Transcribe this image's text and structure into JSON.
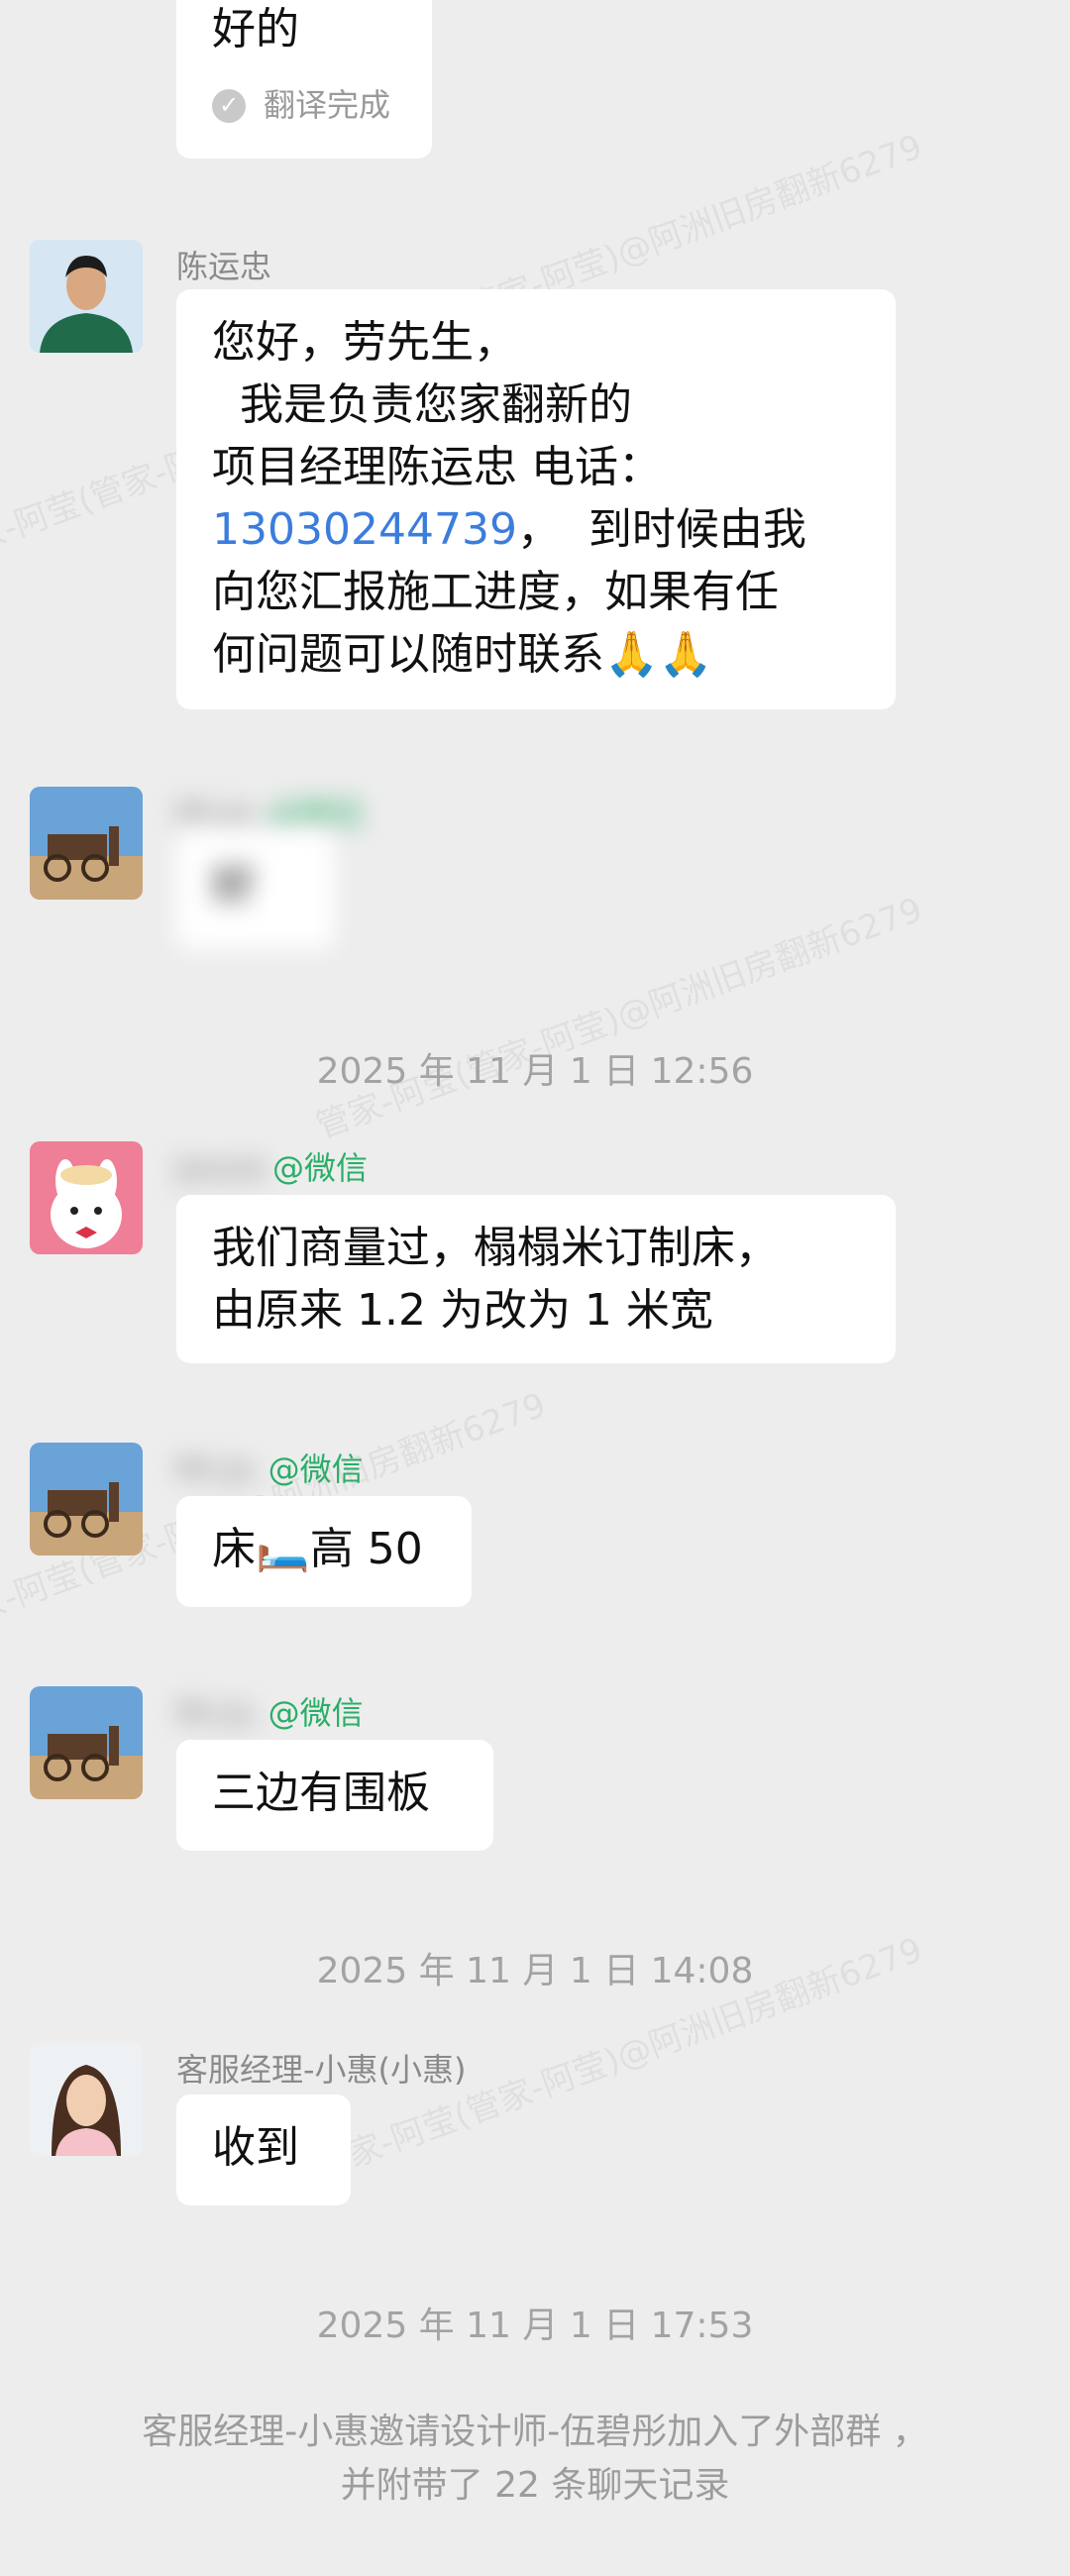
{
  "watermark": "管家-阿莹(管家-阿莹)@阿洲旧房翻新6279",
  "messages": {
    "m0": {
      "text": "好的",
      "translate_status": "翻译完成"
    },
    "m1": {
      "sender": "陈运忠",
      "lines": [
        "您好，劳先生，",
        "  我是负责您家翻新的",
        "项目经理陈运忠 电话："
      ],
      "phone": "13030244739",
      "line4_rest": "，  到时候由我",
      "lines2": [
        "向您汇报施工进度，如果有任",
        "何问题可以随时联系"
      ],
      "emoji": "🙏🙏"
    },
    "m2": {
      "sender": "Mr.Jo.",
      "tag": "@微信",
      "text": "好"
    },
    "time1": "2025 年 11 月 1 日   12:56",
    "m3": {
      "sender": "Jessie",
      "tag": "@微信",
      "lines": [
        "我们商量过，榻榻米订制床，",
        "由原来 1.2 为改为 1 米宽"
      ]
    },
    "m4": {
      "sender": "Mr.Jo.",
      "tag": "@微信",
      "text_a": "床",
      "emoji": "🛏️",
      "text_b": "高 50"
    },
    "m5": {
      "sender": "Mr.Jo.",
      "tag": "@微信",
      "text": "三边有围板"
    },
    "time2": "2025 年 11 月 1 日   14:08",
    "m6": {
      "sender": "客服经理-小惠(小惠)",
      "text": "收到"
    },
    "time3": "2025 年 11 月 1 日   17:53",
    "system": {
      "line1": "客服经理-小惠邀请设计师-伍碧彤加入了外部群 ，",
      "line2": "并附带了 22 条聊天记录"
    }
  },
  "colors": {
    "background": "#ededed",
    "bubble": "#ffffff",
    "wechat_tag": "#2aae67",
    "phone_link": "#3b7ddc"
  }
}
